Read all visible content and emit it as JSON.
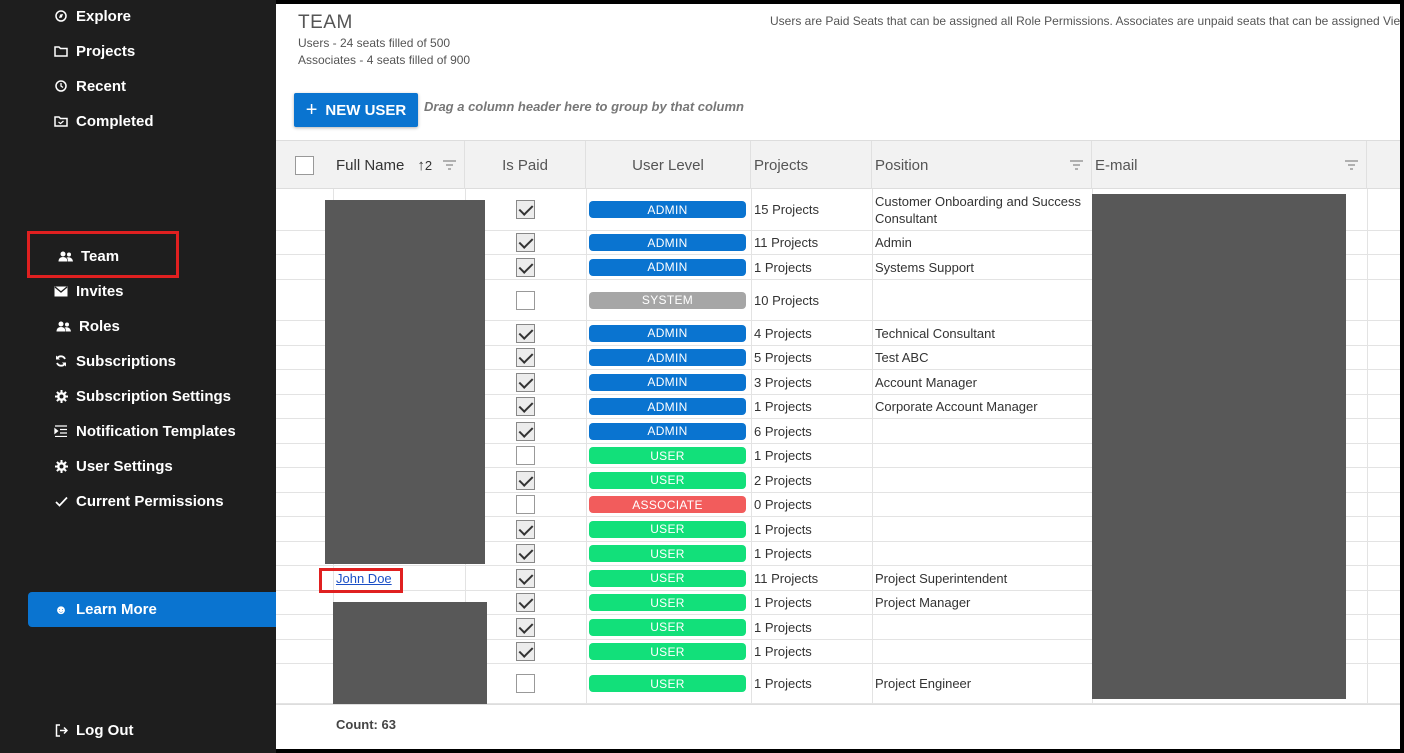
{
  "sidebar": {
    "items": [
      {
        "label": "Explore",
        "icon": "compass-icon"
      },
      {
        "label": "Projects",
        "icon": "folder-icon"
      },
      {
        "label": "Recent",
        "icon": "clock-icon"
      },
      {
        "label": "Completed",
        "icon": "folder-check-icon"
      },
      {
        "label": "Team",
        "icon": "people-icon"
      },
      {
        "label": "Invites",
        "icon": "envelope-icon"
      },
      {
        "label": "Roles",
        "icon": "people-icon"
      },
      {
        "label": "Subscriptions",
        "icon": "refresh-icon"
      },
      {
        "label": "Subscription Settings",
        "icon": "gear-icon"
      },
      {
        "label": "Notification Templates",
        "icon": "list-icon"
      },
      {
        "label": "User Settings",
        "icon": "gear-icon"
      },
      {
        "label": "Current Permissions",
        "icon": "check-icon"
      }
    ],
    "learn_more": "Learn More",
    "log_out": "Log Out"
  },
  "header": {
    "title": "TEAM",
    "users_seats": "Users - 24 seats filled of 500",
    "associates_seats": "Associates - 4 seats filled of 900",
    "info": "Users are Paid Seats that can be assigned all Role Permissions. Associates are unpaid seats that can be assigned Vie"
  },
  "toolbar": {
    "new_user": "NEW USER",
    "group_hint": "Drag a column header here to group by that column"
  },
  "grid": {
    "columns": {
      "full_name": "Full Name",
      "sort_indicator": "2",
      "is_paid": "Is Paid",
      "user_level": "User Level",
      "projects": "Projects",
      "position": "Position",
      "email": "E-mail"
    },
    "rows": [
      {
        "name": "",
        "paid": true,
        "level": "ADMIN",
        "projects": "15 Projects",
        "position": "Customer Onboarding and Success Consultant"
      },
      {
        "name": "",
        "paid": true,
        "level": "ADMIN",
        "projects": "11 Projects",
        "position": "Admin"
      },
      {
        "name": "",
        "paid": true,
        "level": "ADMIN",
        "projects": "1 Projects",
        "position": "Systems Support"
      },
      {
        "name": "",
        "paid": false,
        "level": "SYSTEM",
        "projects": "10 Projects",
        "position": ""
      },
      {
        "name": "",
        "paid": true,
        "level": "ADMIN",
        "projects": "4 Projects",
        "position": "Technical Consultant"
      },
      {
        "name": "",
        "paid": true,
        "level": "ADMIN",
        "projects": "5 Projects",
        "position": "Test ABC"
      },
      {
        "name": "",
        "paid": true,
        "level": "ADMIN",
        "projects": "3 Projects",
        "position": "Account Manager"
      },
      {
        "name": "",
        "paid": true,
        "level": "ADMIN",
        "projects": "1 Projects",
        "position": "Corporate Account Manager"
      },
      {
        "name": "",
        "paid": true,
        "level": "ADMIN",
        "projects": "6 Projects",
        "position": ""
      },
      {
        "name": "",
        "paid": false,
        "level": "USER",
        "projects": "1 Projects",
        "position": ""
      },
      {
        "name": "",
        "paid": true,
        "level": "USER",
        "projects": "2 Projects",
        "position": ""
      },
      {
        "name": "",
        "paid": false,
        "level": "ASSOCIATE",
        "projects": "0 Projects",
        "position": ""
      },
      {
        "name": "",
        "paid": true,
        "level": "USER",
        "projects": "1 Projects",
        "position": ""
      },
      {
        "name": "",
        "paid": true,
        "level": "USER",
        "projects": "1 Projects",
        "position": ""
      },
      {
        "name": "John Doe",
        "paid": true,
        "level": "USER",
        "projects": "11 Projects",
        "position": "Project Superintendent"
      },
      {
        "name": "",
        "paid": true,
        "level": "USER",
        "projects": "1 Projects",
        "position": "Project Manager"
      },
      {
        "name": "",
        "paid": true,
        "level": "USER",
        "projects": "1 Projects",
        "position": ""
      },
      {
        "name": "",
        "paid": true,
        "level": "USER",
        "projects": "1 Projects",
        "position": ""
      },
      {
        "name": "",
        "paid": false,
        "level": "USER",
        "projects": "1 Projects",
        "position": "Project Engineer"
      }
    ],
    "count": "Count: 63"
  },
  "colors": {
    "sidebar_bg": "#1e1e1e",
    "accent": "#0a74d0",
    "admin": "#0a74d0",
    "system": "#a6a6a6",
    "user": "#12e07a",
    "associate": "#f25c5c",
    "highlight": "#e02020"
  }
}
